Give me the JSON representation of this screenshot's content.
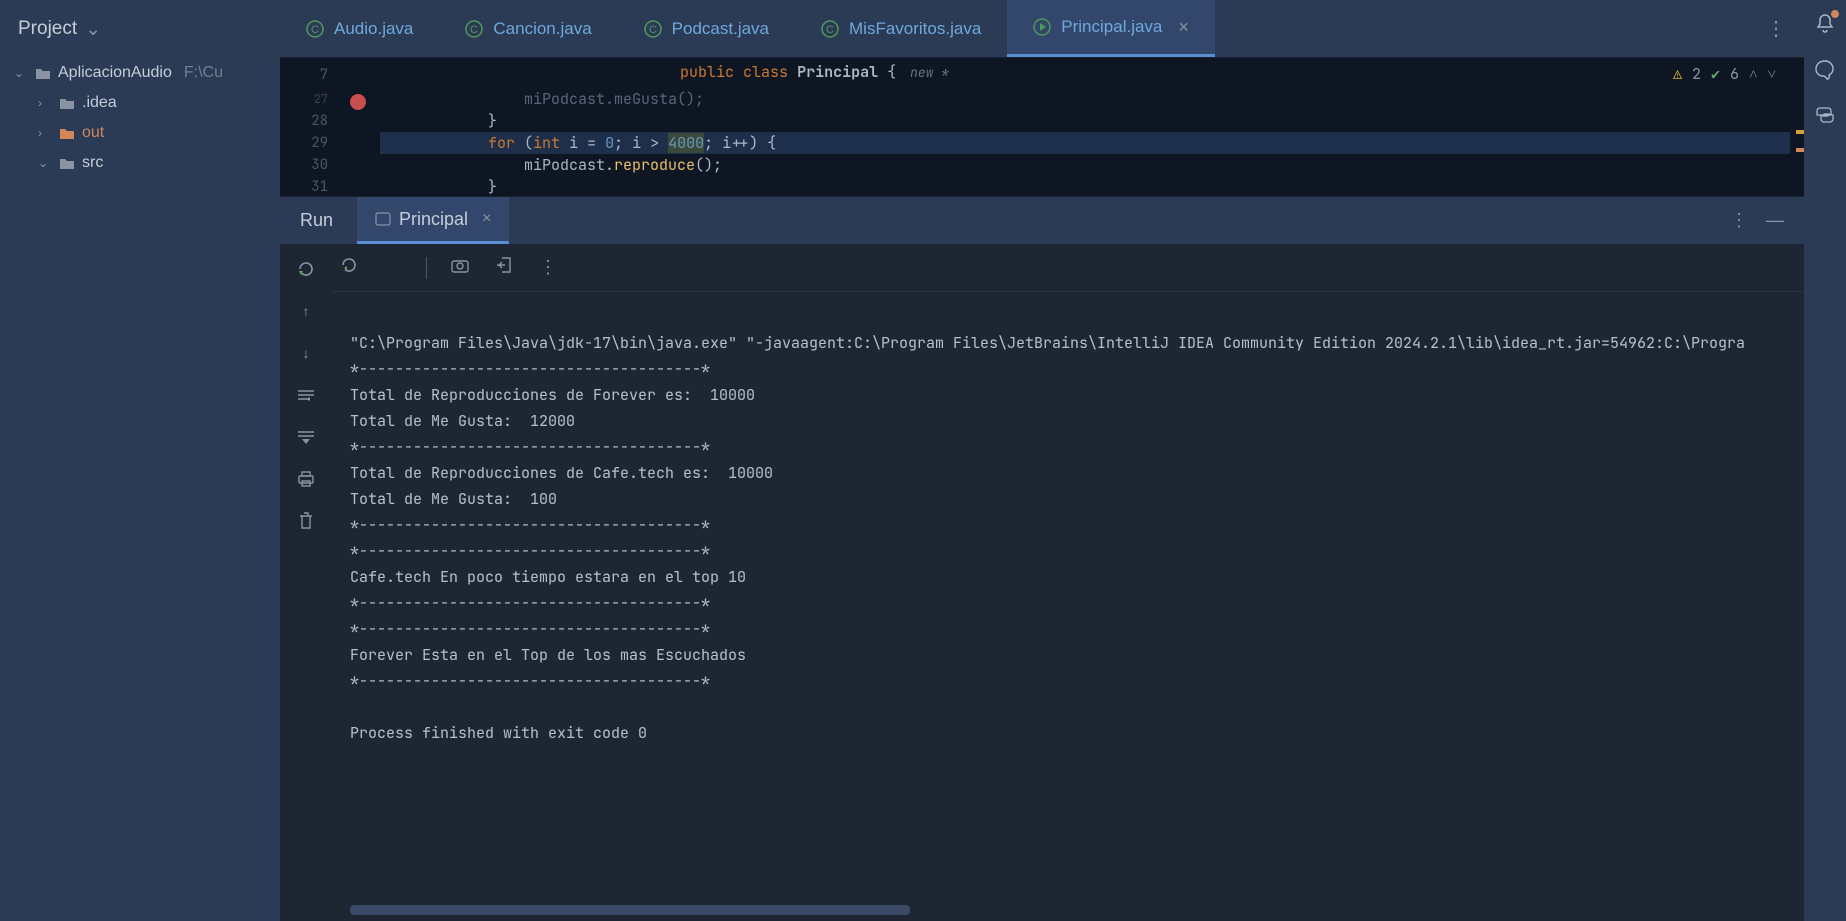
{
  "project": {
    "header": "Project",
    "root_name": "AplicacionAudio",
    "root_path": "F:\\Cu",
    "folders": [
      {
        "name": ".idea",
        "expanded": false,
        "color": "#c5cdd9"
      },
      {
        "name": "out",
        "expanded": false,
        "color": "#d1875a"
      },
      {
        "name": "src",
        "expanded": true,
        "color": "#c5cdd9"
      }
    ]
  },
  "tabs": [
    {
      "label": "Audio.java",
      "icon": "class-c",
      "active": false
    },
    {
      "label": "Cancion.java",
      "icon": "class-c",
      "active": false
    },
    {
      "label": "Podcast.java",
      "icon": "class-c",
      "active": false
    },
    {
      "label": "MisFavoritos.java",
      "icon": "class-c",
      "active": false
    },
    {
      "label": "Principal.java",
      "icon": "run-c",
      "active": true
    }
  ],
  "breadcrumb": {
    "line_number": "7",
    "kw_public": "public",
    "kw_class": "class",
    "class_name": "Principal",
    "brace": "{",
    "hint": "new *"
  },
  "inspections": {
    "warn_count": "2",
    "ok_count": "6"
  },
  "code": {
    "lines": [
      "27",
      "28",
      "29",
      "30",
      "31"
    ],
    "l27": "                miPodcast.meGusta();",
    "l28_brace": "            }",
    "l29_for": "for",
    "l29_rest_open": " (",
    "l29_int": "int",
    "l29_decl": " i = ",
    "l29_zero": "0",
    "l29_sep": "; i > ",
    "l29_limit": "4000",
    "l29_inc": "; i++) {",
    "l30_obj": "                miPodcast",
    "l30_dot": ".",
    "l30_method": "reproduce",
    "l30_call": "();",
    "l31_brace": "            }"
  },
  "run": {
    "title": "Run",
    "tab_label": "Principal",
    "output": [
      "\"C:\\Program Files\\Java\\jdk-17\\bin\\java.exe\" \"-javaagent:C:\\Program Files\\JetBrains\\IntelliJ IDEA Community Edition 2024.2.1\\lib\\idea_rt.jar=54962:C:\\Progra",
      "*--------------------------------------*",
      "Total de Reproducciones de Forever es:  10000",
      "Total de Me Gusta:  12000",
      "*--------------------------------------*",
      "Total de Reproducciones de Cafe.tech es:  10000",
      "Total de Me Gusta:  100",
      "*--------------------------------------*",
      "*--------------------------------------*",
      "Cafe.tech En poco tiempo estara en el top 10",
      "*--------------------------------------*",
      "*--------------------------------------*",
      "Forever Esta en el Top de los mas Escuchados",
      "*--------------------------------------*",
      "",
      "Process finished with exit code 0"
    ]
  }
}
